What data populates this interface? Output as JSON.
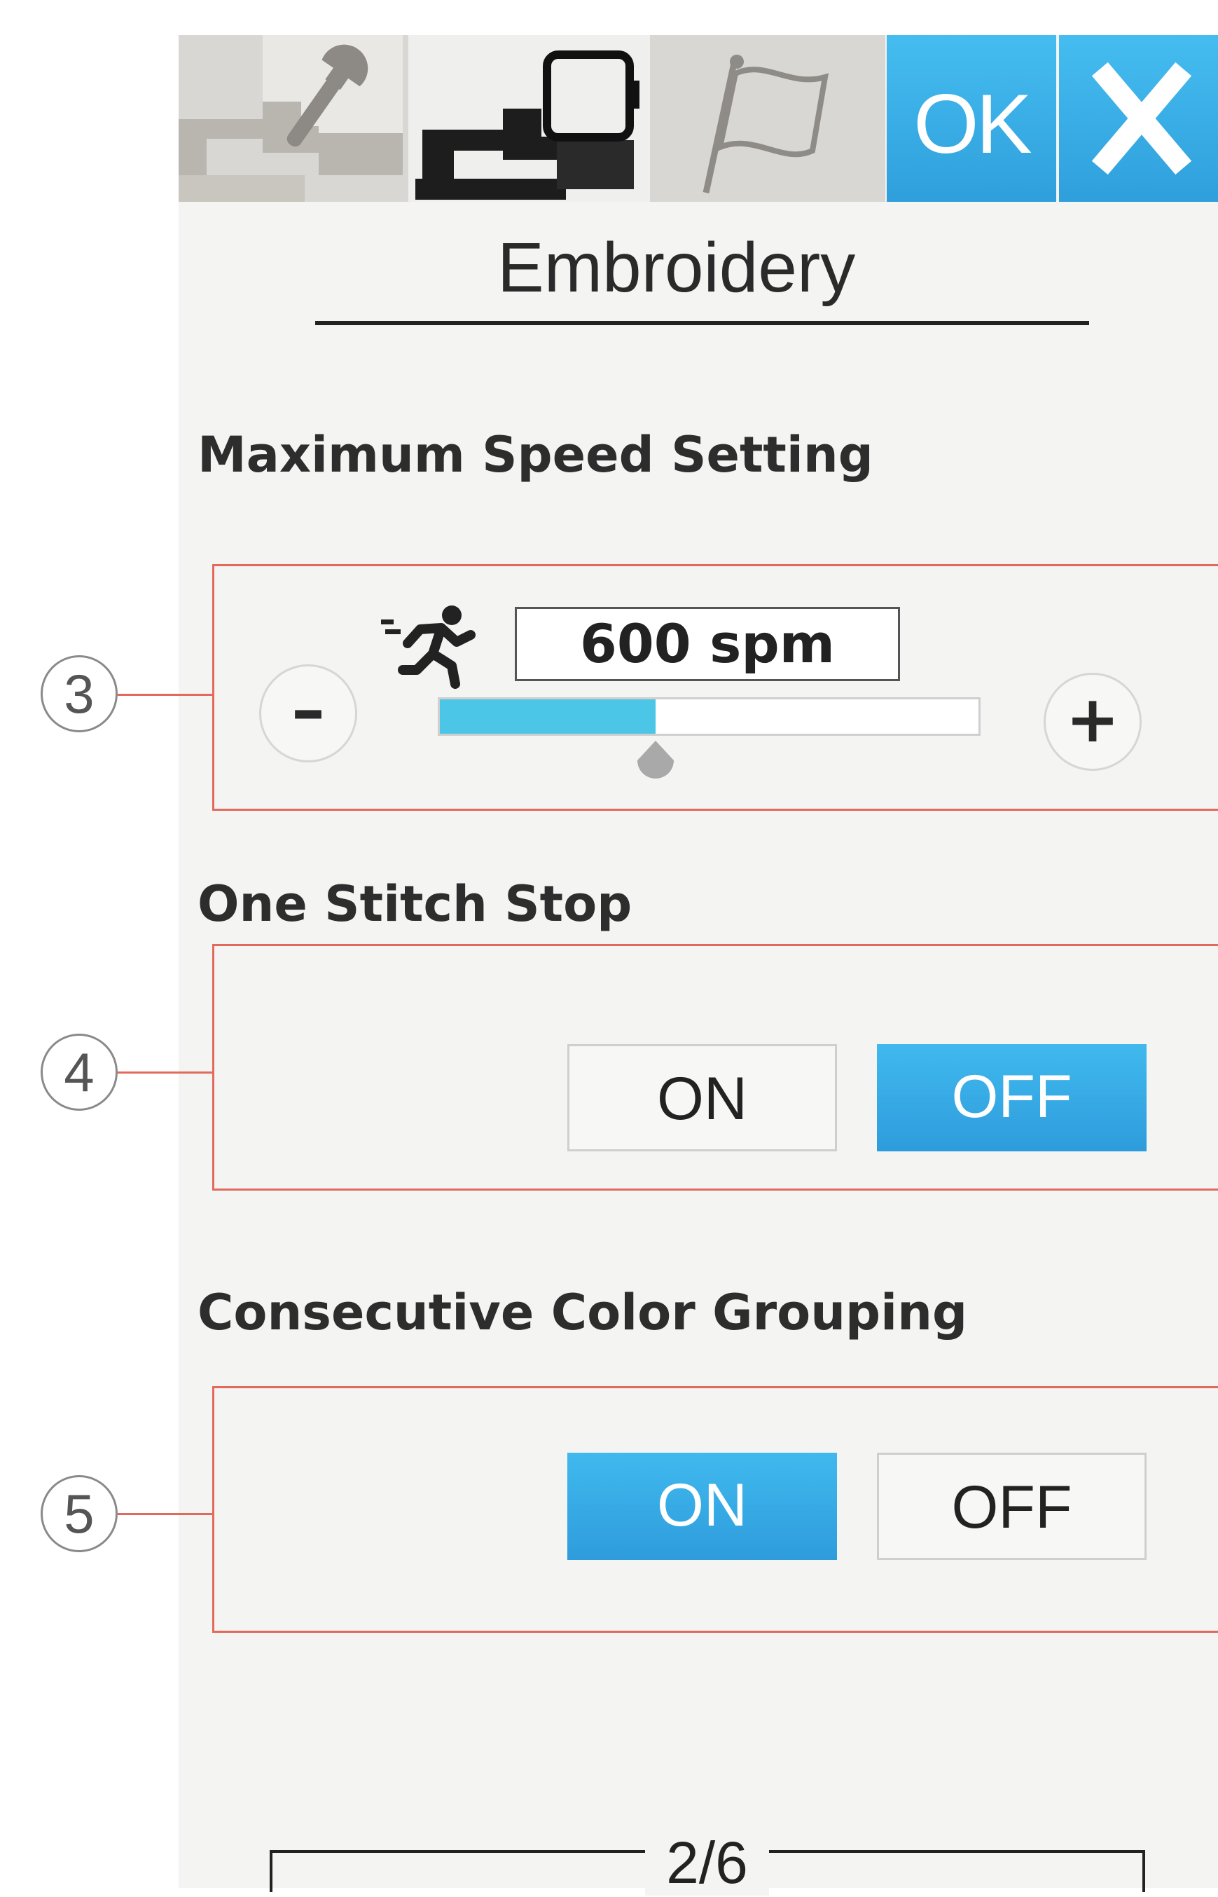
{
  "tabs": {
    "machine_settings_icon": "wrench-machine-icon",
    "embroidery_settings_icon": "embroidery-machine-icon",
    "language_icon": "flag-icon",
    "ok_label": "OK",
    "close_icon": "close-icon"
  },
  "screen": {
    "title": "Embroidery"
  },
  "speed": {
    "label": "Maximum Speed Setting",
    "callout": "3",
    "value": "600 spm",
    "level_fraction": 0.4,
    "decrease_icon": "minus-icon",
    "increase_icon": "plus-icon",
    "speed_icon": "running-figure-icon"
  },
  "one_stitch_stop": {
    "label": "One Stitch Stop",
    "callout": "4",
    "on_label": "ON",
    "off_label": "OFF",
    "selected": "OFF"
  },
  "color_grouping": {
    "label": "Consecutive Color Grouping",
    "callout": "5",
    "on_label": "ON",
    "off_label": "OFF",
    "selected": "ON"
  },
  "pagination": {
    "label": "2/6"
  },
  "colors": {
    "accent": "#3aaee6",
    "frame": "#e26a5c",
    "slider_fill": "#4cc6e6"
  }
}
